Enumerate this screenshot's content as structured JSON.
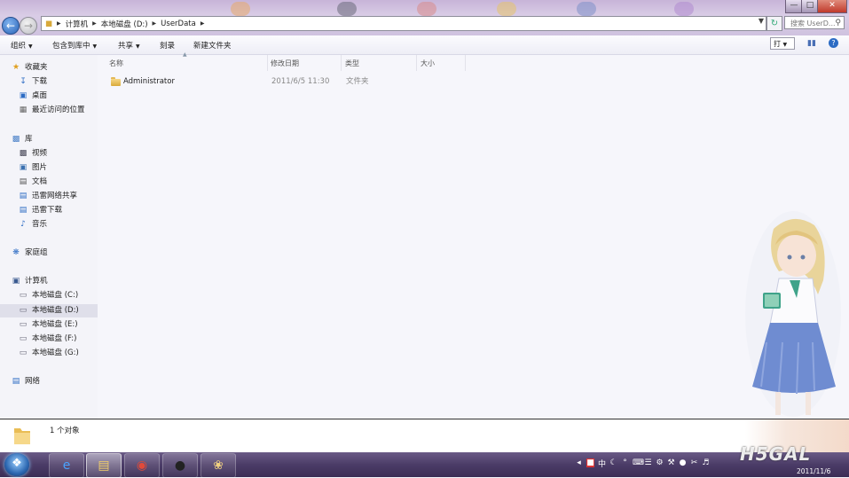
{
  "window": {
    "address": {
      "crumbs": [
        "计算机",
        "本地磁盘 (D:)",
        "UserData"
      ]
    },
    "search_placeholder": "搜索 UserD..."
  },
  "toolbar": {
    "organize": "组织",
    "include_in_library": "包含到库中",
    "share": "共享",
    "burn": "刻录",
    "new_folder": "新建文件夹",
    "view": "打"
  },
  "navpane": {
    "favorites": {
      "label": "收藏夹",
      "items": [
        "下载",
        "桌面",
        "最近访问的位置"
      ]
    },
    "libraries": {
      "label": "库",
      "items": [
        "视频",
        "图片",
        "文档",
        "迅雷网络共享",
        "迅雷下载",
        "音乐"
      ]
    },
    "homegroup": "家庭组",
    "computer": {
      "label": "计算机",
      "items": [
        "本地磁盘 (C:)",
        "本地磁盘 (D:)",
        "本地磁盘 (E:)",
        "本地磁盘 (F:)",
        "本地磁盘 (G:)"
      ],
      "selected": "本地磁盘 (D:)"
    },
    "network": "网络"
  },
  "columns": [
    "名称",
    "修改日期",
    "类型",
    "大小"
  ],
  "files": [
    {
      "name": "Administrator",
      "modified": "2011/6/5 11:30",
      "type": "文件夹",
      "size": ""
    }
  ],
  "status": {
    "count": "1 个对象"
  },
  "taskbar": {
    "apps": [
      "ie-icon",
      "explorer-icon",
      "chrome-icon",
      "qq-icon",
      "paint-icon"
    ],
    "active": "explorer-icon",
    "clock_date": "2011/11/6"
  },
  "watermark": "H5GAL",
  "colors": {
    "accent": "#2d6cc4",
    "taskbar": "#4b3c67",
    "titlebar": "#cfc2df"
  }
}
